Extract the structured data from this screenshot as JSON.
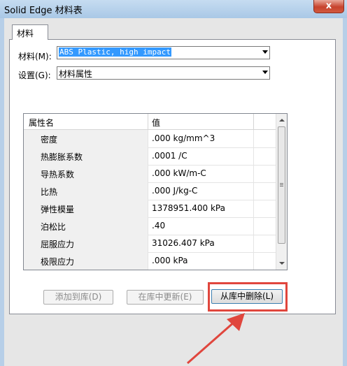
{
  "window": {
    "title": "Solid Edge 材料表",
    "close_label": "x"
  },
  "tabs": [
    {
      "label": "材料"
    }
  ],
  "form": {
    "material_label": "材料(M):",
    "material_value": "ABS Plastic, high impact",
    "settings_label": "设置(G):",
    "settings_value": "材料属性"
  },
  "table": {
    "columns": [
      "属性名",
      "值"
    ],
    "rows": [
      {
        "name": "密度",
        "value": ".000 kg/mm^3"
      },
      {
        "name": "热膨胀系数",
        "value": ".0001 /C"
      },
      {
        "name": "导热系数",
        "value": ".000 kW/m-C"
      },
      {
        "name": "比热",
        "value": ".000 J/kg-C"
      },
      {
        "name": "弹性模量",
        "value": "1378951.400 kPa"
      },
      {
        "name": "泊松比",
        "value": ".40"
      },
      {
        "name": "屈服应力",
        "value": "31026.407 kPa"
      },
      {
        "name": "极限应力",
        "value": ".000 kPa"
      }
    ]
  },
  "buttons": {
    "add": "添加到库(D)",
    "update": "在库中更新(E)",
    "delete": "从库中删除(L)"
  },
  "colors": {
    "highlight": "#e0463d",
    "selection": "#3399ff"
  }
}
